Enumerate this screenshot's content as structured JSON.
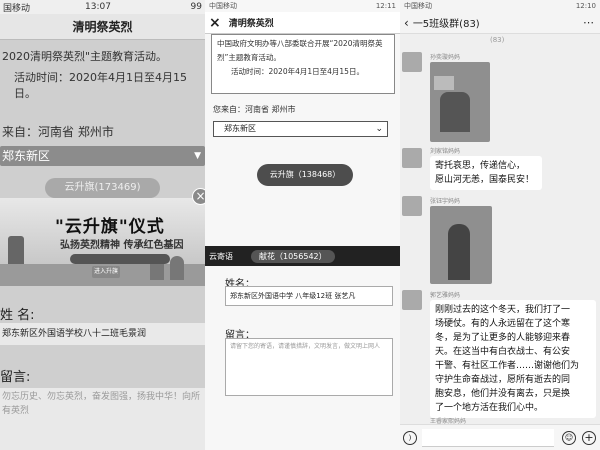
{
  "panel1": {
    "status": {
      "carrier": "国移动",
      "time": "13:07",
      "battery": "99"
    },
    "header_title": "清明祭英烈",
    "campaign_text": "2020清明祭英烈\"主题教育活动。",
    "activity_text": "活动时间：2020年4月1日至4月15日。",
    "region_text": "来自：河南省 郑州市",
    "region_select": "郑东新区",
    "flag_button": "云升旗(173469)",
    "banner": {
      "title": "\"云升旗\"仪式",
      "slogan": "弘扬英烈精神  传承红色基因",
      "enter_label": "进入升旗"
    },
    "name_label": "姓 名:",
    "name_value": "郑东新区外国语学校八十二班毛景润",
    "message_label": "留言:",
    "message_value": "勿忘历史、勿忘英烈，奋发图强，扬我中华！向所有英烈"
  },
  "panel2": {
    "status": {
      "left": "中国移动",
      "right": "12:11"
    },
    "header_title": "清明祭英烈",
    "card_lines": [
      "中国政府文明办等八部委联合开展“2020清明祭英",
      "烈”主题教育活动。",
      "活动时间：2020年4月1日至4月15日。"
    ],
    "region_text": "您来自：河南省 郑州市",
    "region_select": "郑东新区",
    "raise_button": "云升旗（138468）",
    "bar_left": "云寄语",
    "bar_right": "献花（1056542）",
    "name_label": "姓名：",
    "name_value": "郑东新区外国语中学  八年级12班  张艺凡",
    "message_label": "留言：",
    "message_placeholder": "请留下您的寄语，请谨慎措辞，文明发言，做文明上网人"
  },
  "panel3": {
    "status": {
      "left": "中国移动",
      "right": "12:10"
    },
    "group_title": "一5班级群(83)",
    "count_label": "(83)",
    "messages": [
      {
        "sender": "孙奕璇妈妈"
      },
      {
        "sender": "刘家铭妈妈",
        "lines": [
          "寄托哀思，传递信心，",
          "愿山河无恙，国泰民安！"
        ]
      },
      {
        "sender": "张钰宇妈妈"
      },
      {
        "sender": "郭艺雅妈妈",
        "lines": [
          "刚刚过去的这个冬天，我们打了一",
          "场硬仗。有的人永远留在了这个寒",
          "冬，是为了让更多的人能够迎来春",
          "天。在这当中有白衣战士、有公安",
          "干警、有社区工作者……谢谢他们为",
          "守护生命奋战过，愿所有逝去的同",
          "胞安息，他们并没有离去，只是换",
          "了一个地方活在我们心中。"
        ]
      },
      {
        "sender": "王睿家熙妈妈"
      }
    ]
  }
}
